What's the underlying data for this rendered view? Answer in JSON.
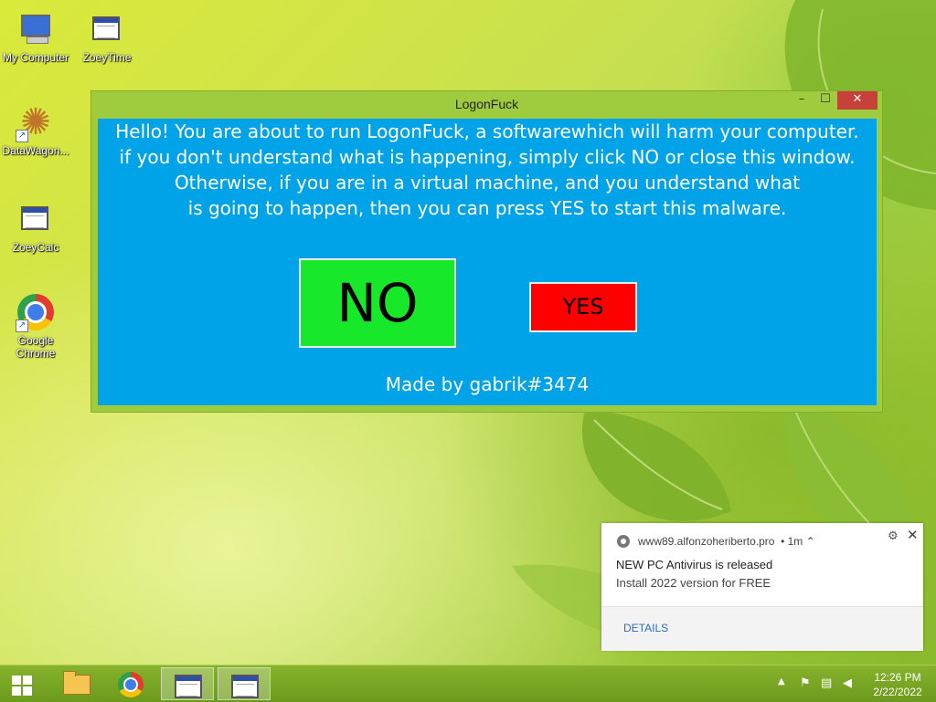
{
  "desktop": {
    "icons": [
      {
        "label": "My Computer",
        "icon": "my-computer-icon"
      },
      {
        "label": "ZoeyTime",
        "icon": "application-window-icon"
      },
      {
        "label": "DataWagon...",
        "icon": "datawagon-icon"
      },
      {
        "label": "ZoeyCalc",
        "icon": "application-window-icon"
      },
      {
        "label": "Google Chrome",
        "icon": "chrome-icon"
      }
    ]
  },
  "window": {
    "title": "LogonFuck",
    "controls": {
      "minimize": "–",
      "maximize": "☐",
      "close": "✕"
    },
    "message_lines": [
      "Hello! You are about to run LogonFuck, a softwarewhich will harm your computer.",
      "if you don't understand what is happening, simply click NO or close this window.",
      "Otherwise, if you are in a virtual machine, and you understand what",
      "is going to happen, then you can press YES to start this malware."
    ],
    "no_label": "NO",
    "yes_label": "YES",
    "credit": "Made by gabrik#3474",
    "colors": {
      "frame": "#9fcc3f",
      "client": "#00a2e8",
      "no": "#17e82a",
      "yes": "#ff0000",
      "close": "#c7403a"
    }
  },
  "notification": {
    "source": "www89.alfonzoheriberto.pro",
    "age": "• 1m ⌃",
    "title": "NEW PC Antivirus is released",
    "body": "Install 2022 version for FREE",
    "details_label": "DETAILS"
  },
  "taskbar": {
    "items": [
      "start-button",
      "file-explorer",
      "google-chrome",
      "app-window-1",
      "app-window-2"
    ],
    "tray": {
      "chevron": "▲",
      "icons": [
        "action-center-icon",
        "network-icon",
        "volume-muted-icon"
      ]
    },
    "clock": {
      "time": "12:26 PM",
      "date": "2/22/2022"
    }
  }
}
